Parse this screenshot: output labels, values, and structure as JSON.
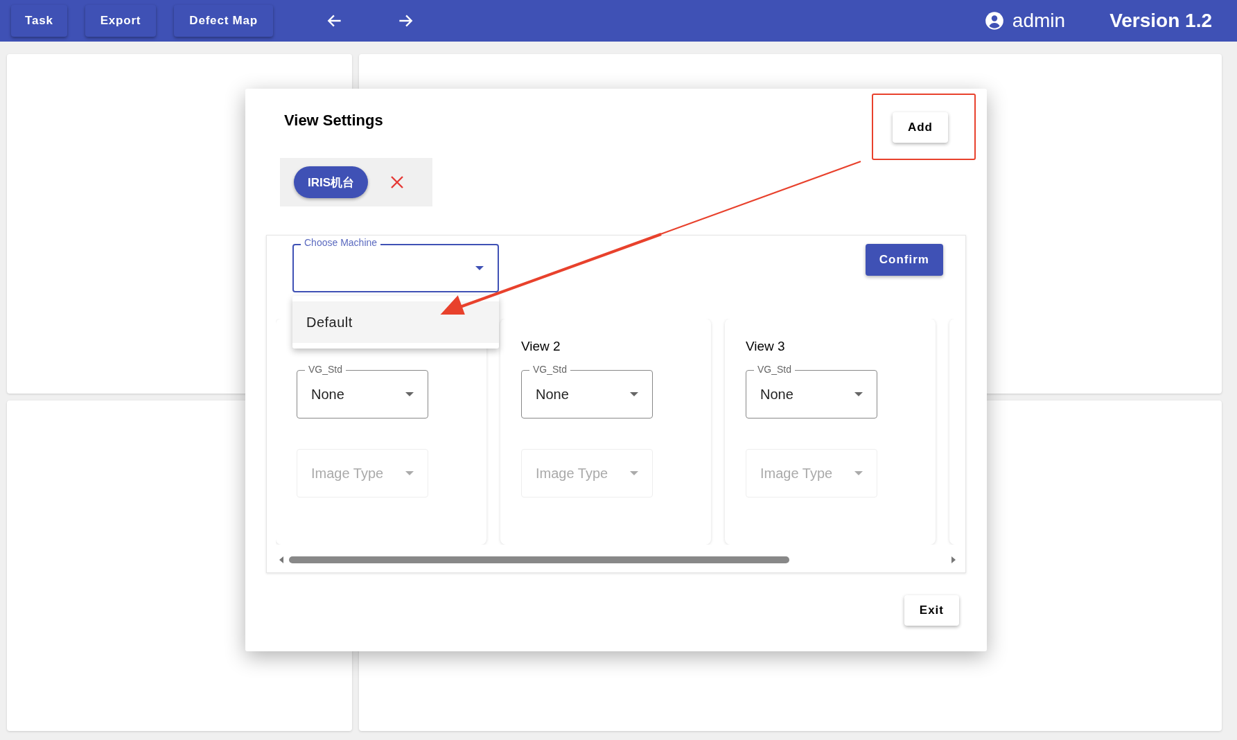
{
  "toolbar": {
    "buttons": [
      {
        "label": "Task"
      },
      {
        "label": "Export"
      },
      {
        "label": "Defect Map"
      }
    ],
    "user": "admin",
    "version": "Version 1.2"
  },
  "dialog": {
    "title": "View Settings",
    "add_button": "Add",
    "chips": [
      {
        "label": "IRIS机台",
        "selected": true
      }
    ],
    "machine_select": {
      "label": "Choose Machine",
      "expanded": true,
      "options": [
        {
          "label": "Default",
          "selected": true
        }
      ]
    },
    "confirm_button": "Confirm",
    "views": [
      {
        "vg_std": {
          "label": "VG_Std",
          "value": "None"
        },
        "image_type": {
          "placeholder": "Image Type",
          "disabled": true
        }
      },
      {
        "title": "View 2",
        "vg_std": {
          "label": "VG_Std",
          "value": "None"
        },
        "image_type": {
          "placeholder": "Image Type",
          "disabled": true
        }
      },
      {
        "title": "View 3",
        "vg_std": {
          "label": "VG_Std",
          "value": "None"
        },
        "image_type": {
          "placeholder": "Image Type",
          "disabled": true
        }
      }
    ],
    "exit_button": "Exit"
  }
}
